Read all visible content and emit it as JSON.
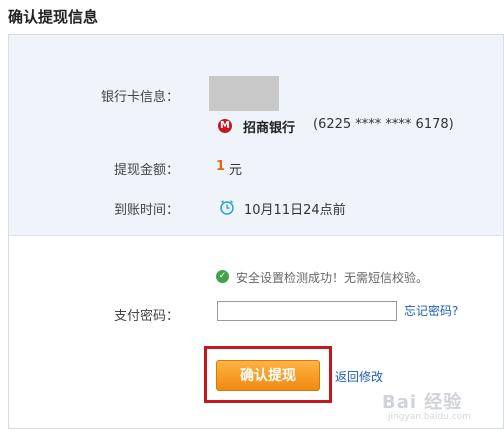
{
  "title": "确认提现信息",
  "bank_card": {
    "label": "银行卡信息：",
    "bank_logo_text": "M",
    "bank_name": "招商银行",
    "card_number": "(6225 **** **** 6178)"
  },
  "amount": {
    "label": "提现金额：",
    "value": "1",
    "unit": "元"
  },
  "arrival": {
    "label": "到账时间：",
    "icon": "clock-icon",
    "value": "10月11日24点前"
  },
  "security": {
    "icon": "check-circle-icon",
    "message": "安全设置检测成功！无需短信校验。"
  },
  "password": {
    "label": "支付密码：",
    "value": "",
    "forgot_link": "忘记密码?"
  },
  "actions": {
    "confirm_label": "确认提现",
    "back_link": "返回修改"
  },
  "watermark": {
    "text": "Bai 经验",
    "sub": "jingyan.baidu.com"
  },
  "colors": {
    "accent_orange": "#f08a12",
    "highlight_red": "#c5171e",
    "link_blue": "#1a5fb4",
    "amount_orange": "#e3641d",
    "panel_bg": "#eef4fa"
  }
}
